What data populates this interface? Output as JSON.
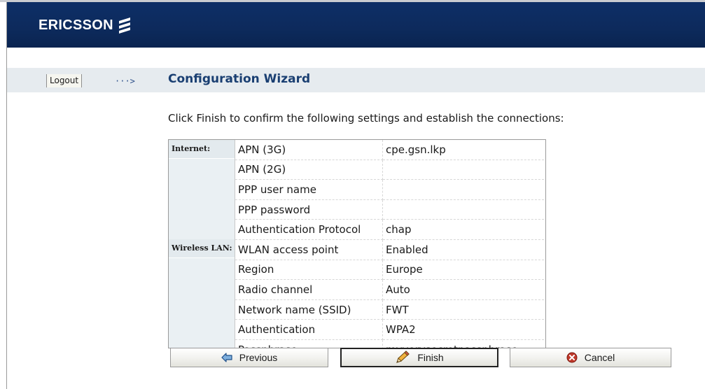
{
  "header": {
    "brand": "ERICSSON"
  },
  "nav": {
    "logout_label": "Logout",
    "arrow": "···>"
  },
  "page": {
    "title": "Configuration Wizard",
    "instruction": "Click Finish to confirm the following settings and establish the connections:"
  },
  "sections": [
    {
      "name": "Internet:",
      "rows": [
        {
          "label": "APN (3G)",
          "value": "cpe.gsn.lkp"
        },
        {
          "label": "APN (2G)",
          "value": ""
        },
        {
          "label": "PPP user name",
          "value": ""
        },
        {
          "label": "PPP password",
          "value": ""
        },
        {
          "label": "Authentication Protocol",
          "value": "chap"
        }
      ]
    },
    {
      "name": "Wireless LAN:",
      "rows": [
        {
          "label": "WLAN access point",
          "value": "Enabled"
        },
        {
          "label": "Region",
          "value": "Europe"
        },
        {
          "label": "Radio channel",
          "value": "Auto"
        },
        {
          "label": "Network name (SSID)",
          "value": "FWT"
        },
        {
          "label": "Authentication",
          "value": "WPA2"
        },
        {
          "label": "Passphrase",
          "value": "myverysecretpassphrase"
        }
      ]
    }
  ],
  "buttons": {
    "previous": "Previous",
    "finish": "Finish",
    "cancel": "Cancel"
  },
  "colors": {
    "header_bg": "#0d2f67",
    "title": "#1a3f72",
    "nav_band": "#e6ebef",
    "cancel_icon": "#c0392b"
  }
}
